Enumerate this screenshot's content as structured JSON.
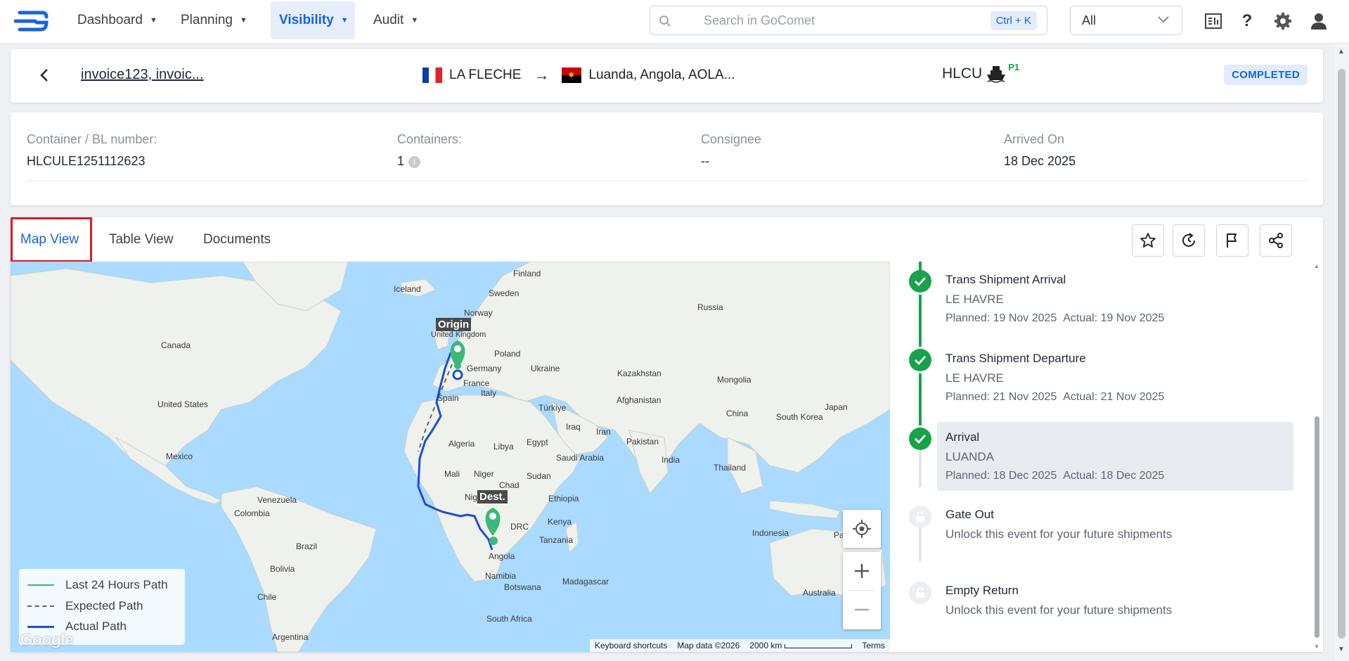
{
  "nav": {
    "items": [
      {
        "label": "Dashboard"
      },
      {
        "label": "Planning"
      },
      {
        "label": "Visibility"
      },
      {
        "label": "Audit"
      }
    ],
    "search_placeholder": "Search in GoComet",
    "search_shortcut": "Ctrl + K",
    "scope_select": "All"
  },
  "shipment": {
    "reference": "invoice123, invoic...",
    "origin": "LA FLECHE",
    "arrow": "→",
    "destination": "Luanda, Angola, AOLA...",
    "carrier": "HLCU",
    "priority": "P1",
    "status": "COMPLETED"
  },
  "info": {
    "bl_label": "Container / BL number:",
    "bl_value": "HLCULE1251112623",
    "containers_label": "Containers:",
    "containers_value": "1",
    "containers_info": "i",
    "consignee_label": "Consignee",
    "consignee_value": "--",
    "arrived_label": "Arrived On",
    "arrived_value": "18 Dec 2025"
  },
  "tabs": [
    {
      "label": "Map View"
    },
    {
      "label": "Table View"
    },
    {
      "label": "Documents"
    }
  ],
  "map": {
    "labels": {
      "finland": "Finland",
      "iceland": "Iceland",
      "sweden": "Sweden",
      "norway": "Norway",
      "russia": "Russia",
      "canada": "Canada",
      "poland": "Poland",
      "united_kingdom": "United Kingdom",
      "germany": "Germany",
      "ukraine": "Ukraine",
      "kazakhstan": "Kazakhstan",
      "mongolia": "Mongolia",
      "france": "France",
      "united_states": "United States",
      "spain": "Spain",
      "italy": "Italy",
      "turkiye": "Türkiye",
      "japan": "Japan",
      "south_korea": "South Korea",
      "china": "China",
      "afghanistan": "Afghanistan",
      "iraq": "Iraq",
      "iran": "Iran",
      "pakistan": "Pakistan",
      "algeria": "Algeria",
      "libya": "Libya",
      "egypt": "Egypt",
      "saudi_arabia": "Saudi Arabia",
      "mexico": "Mexico",
      "india": "India",
      "thailand": "Thailand",
      "mali": "Mali",
      "niger": "Niger",
      "chad": "Chad",
      "sudan": "Sudan",
      "nigeria": "Nig",
      "ethiopia": "Ethiopia",
      "venezuela": "Venezuela",
      "colombia": "Colombia",
      "kenya": "Kenya",
      "drc": "DRC",
      "tanzania": "Tanzania",
      "indonesia": "Indonesia",
      "papua": "Pa",
      "brazil": "Brazil",
      "angola": "Angola",
      "bolivia": "Bolivia",
      "namibia": "Namibia",
      "madagascar": "Madagascar",
      "botswana": "Botswana",
      "australia": "Australia",
      "chile": "Chile",
      "south_africa": "South Africa",
      "argentina": "Argentina"
    },
    "origin_tag": "Origin",
    "dest_tag": "Dest.",
    "legend": [
      {
        "label": "Last 24 Hours Path",
        "color": "#3cb878"
      },
      {
        "label": "Expected Path",
        "color": "#666666"
      },
      {
        "label": "Actual Path",
        "color": "#1d4ed8"
      }
    ],
    "attribution": {
      "shortcuts": "Keyboard shortcuts",
      "data": "Map data ©2026",
      "scale": "2000 km",
      "terms": "Terms"
    },
    "watermark": "Google"
  },
  "events": [
    {
      "title": "Trans Shipment Arrival",
      "location": "LE HAVRE",
      "planned": "Planned: 19 Nov 2025",
      "actual": "Actual: 19 Nov 2025"
    },
    {
      "title": "Trans Shipment Departure",
      "location": "LE HAVRE",
      "planned": "Planned: 21 Nov 2025",
      "actual": "Actual: 21 Nov 2025"
    },
    {
      "title": "Arrival",
      "location": "LUANDA",
      "planned": "Planned: 18 Dec 2025",
      "actual": "Actual: 18 Dec 2025"
    },
    {
      "title": "Gate Out",
      "note": "Unlock this event for your future shipments"
    },
    {
      "title": "Empty Return",
      "note": "Unlock this event for your future shipments"
    }
  ],
  "colors": {
    "accent": "#1565e0",
    "success": "#17a34a",
    "highlight": "#d81e25"
  }
}
